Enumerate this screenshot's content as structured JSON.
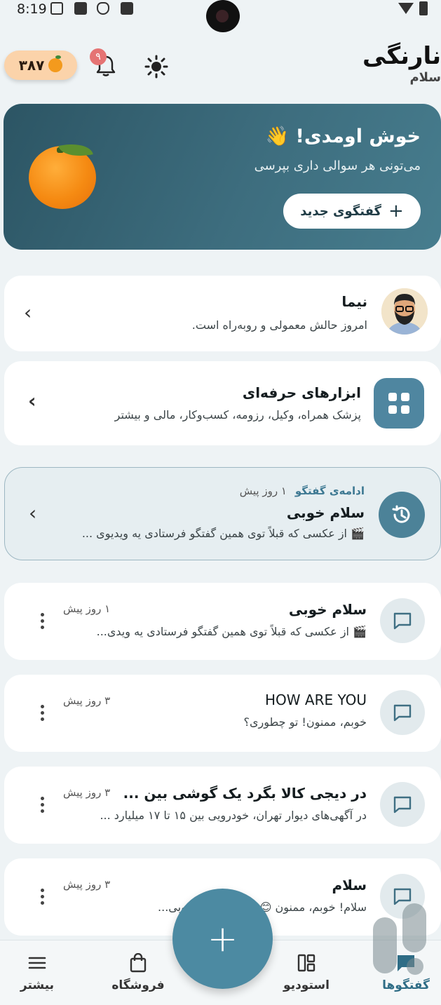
{
  "status_bar": {
    "time": "8:19"
  },
  "header": {
    "app_title": "نارنگی",
    "greeting": "سلام",
    "coin_balance": "۳۸۷",
    "notification_count": "۹"
  },
  "hero": {
    "title": "خوش اومدی! 👋",
    "subtitle": "می‌تونی هر سوالی داری بپرسی",
    "new_chat_label": "گفتگوی جدید"
  },
  "persona_card": {
    "name": "نیما",
    "status": "امروز حالش معمولی و روبه‌راه است."
  },
  "tools_card": {
    "title": "ابزارهای حرفه‌ای",
    "subtitle": "پزشک همراه، وکیل، رزومه، کسب‌وکار، مالی و بیشتر"
  },
  "continue_card": {
    "label": "ادامه‌ی گفتگو",
    "time": "۱ روز پیش",
    "title": "سلام خوبی",
    "preview": "🎬 از عکسی که قبلاً توی همین گفتگو فرستادی یه ویدیوی ..."
  },
  "conversations": [
    {
      "title": "سلام خوبی",
      "time": "۱ روز پیش",
      "preview": "🎬 از عکسی که قبلاً توی همین گفتگو فرستادی یه ویدی..."
    },
    {
      "title": "HOW ARE YOU",
      "time": "۳ روز پیش",
      "preview": "خوبم، ممنون! تو چطوری؟"
    },
    {
      "title": "در دیجی کالا بگرد یک گوشی بین ...",
      "time": "۳ روز پیش",
      "preview": "در آگهی‌های دیوار تهران، خودرویی بین ۱۵ تا ۱۷ میلیارد ..."
    },
    {
      "title": "سلام",
      "time": "۳ روز پیش",
      "preview": "سلام! خوبم، ممنون 😊 امیدوارم روز خوبی..."
    }
  ],
  "bottom_nav": {
    "chats": "گفتگوها",
    "studio": "استودیو",
    "shop": "فروشگاه",
    "more": "بیشتر"
  },
  "colors": {
    "accent": "#4c8aa2",
    "hero_bg": "#2c5564",
    "badge": "#e57373"
  },
  "icons": [
    "shield-icon",
    "bell-icon",
    "sun-icon",
    "chevron-left-icon",
    "grid-icon",
    "history-icon",
    "chat-bubble-icon",
    "kebab-icon",
    "menu-icon",
    "shopping-bag-icon",
    "dashboard-icon",
    "plus-icon"
  ]
}
